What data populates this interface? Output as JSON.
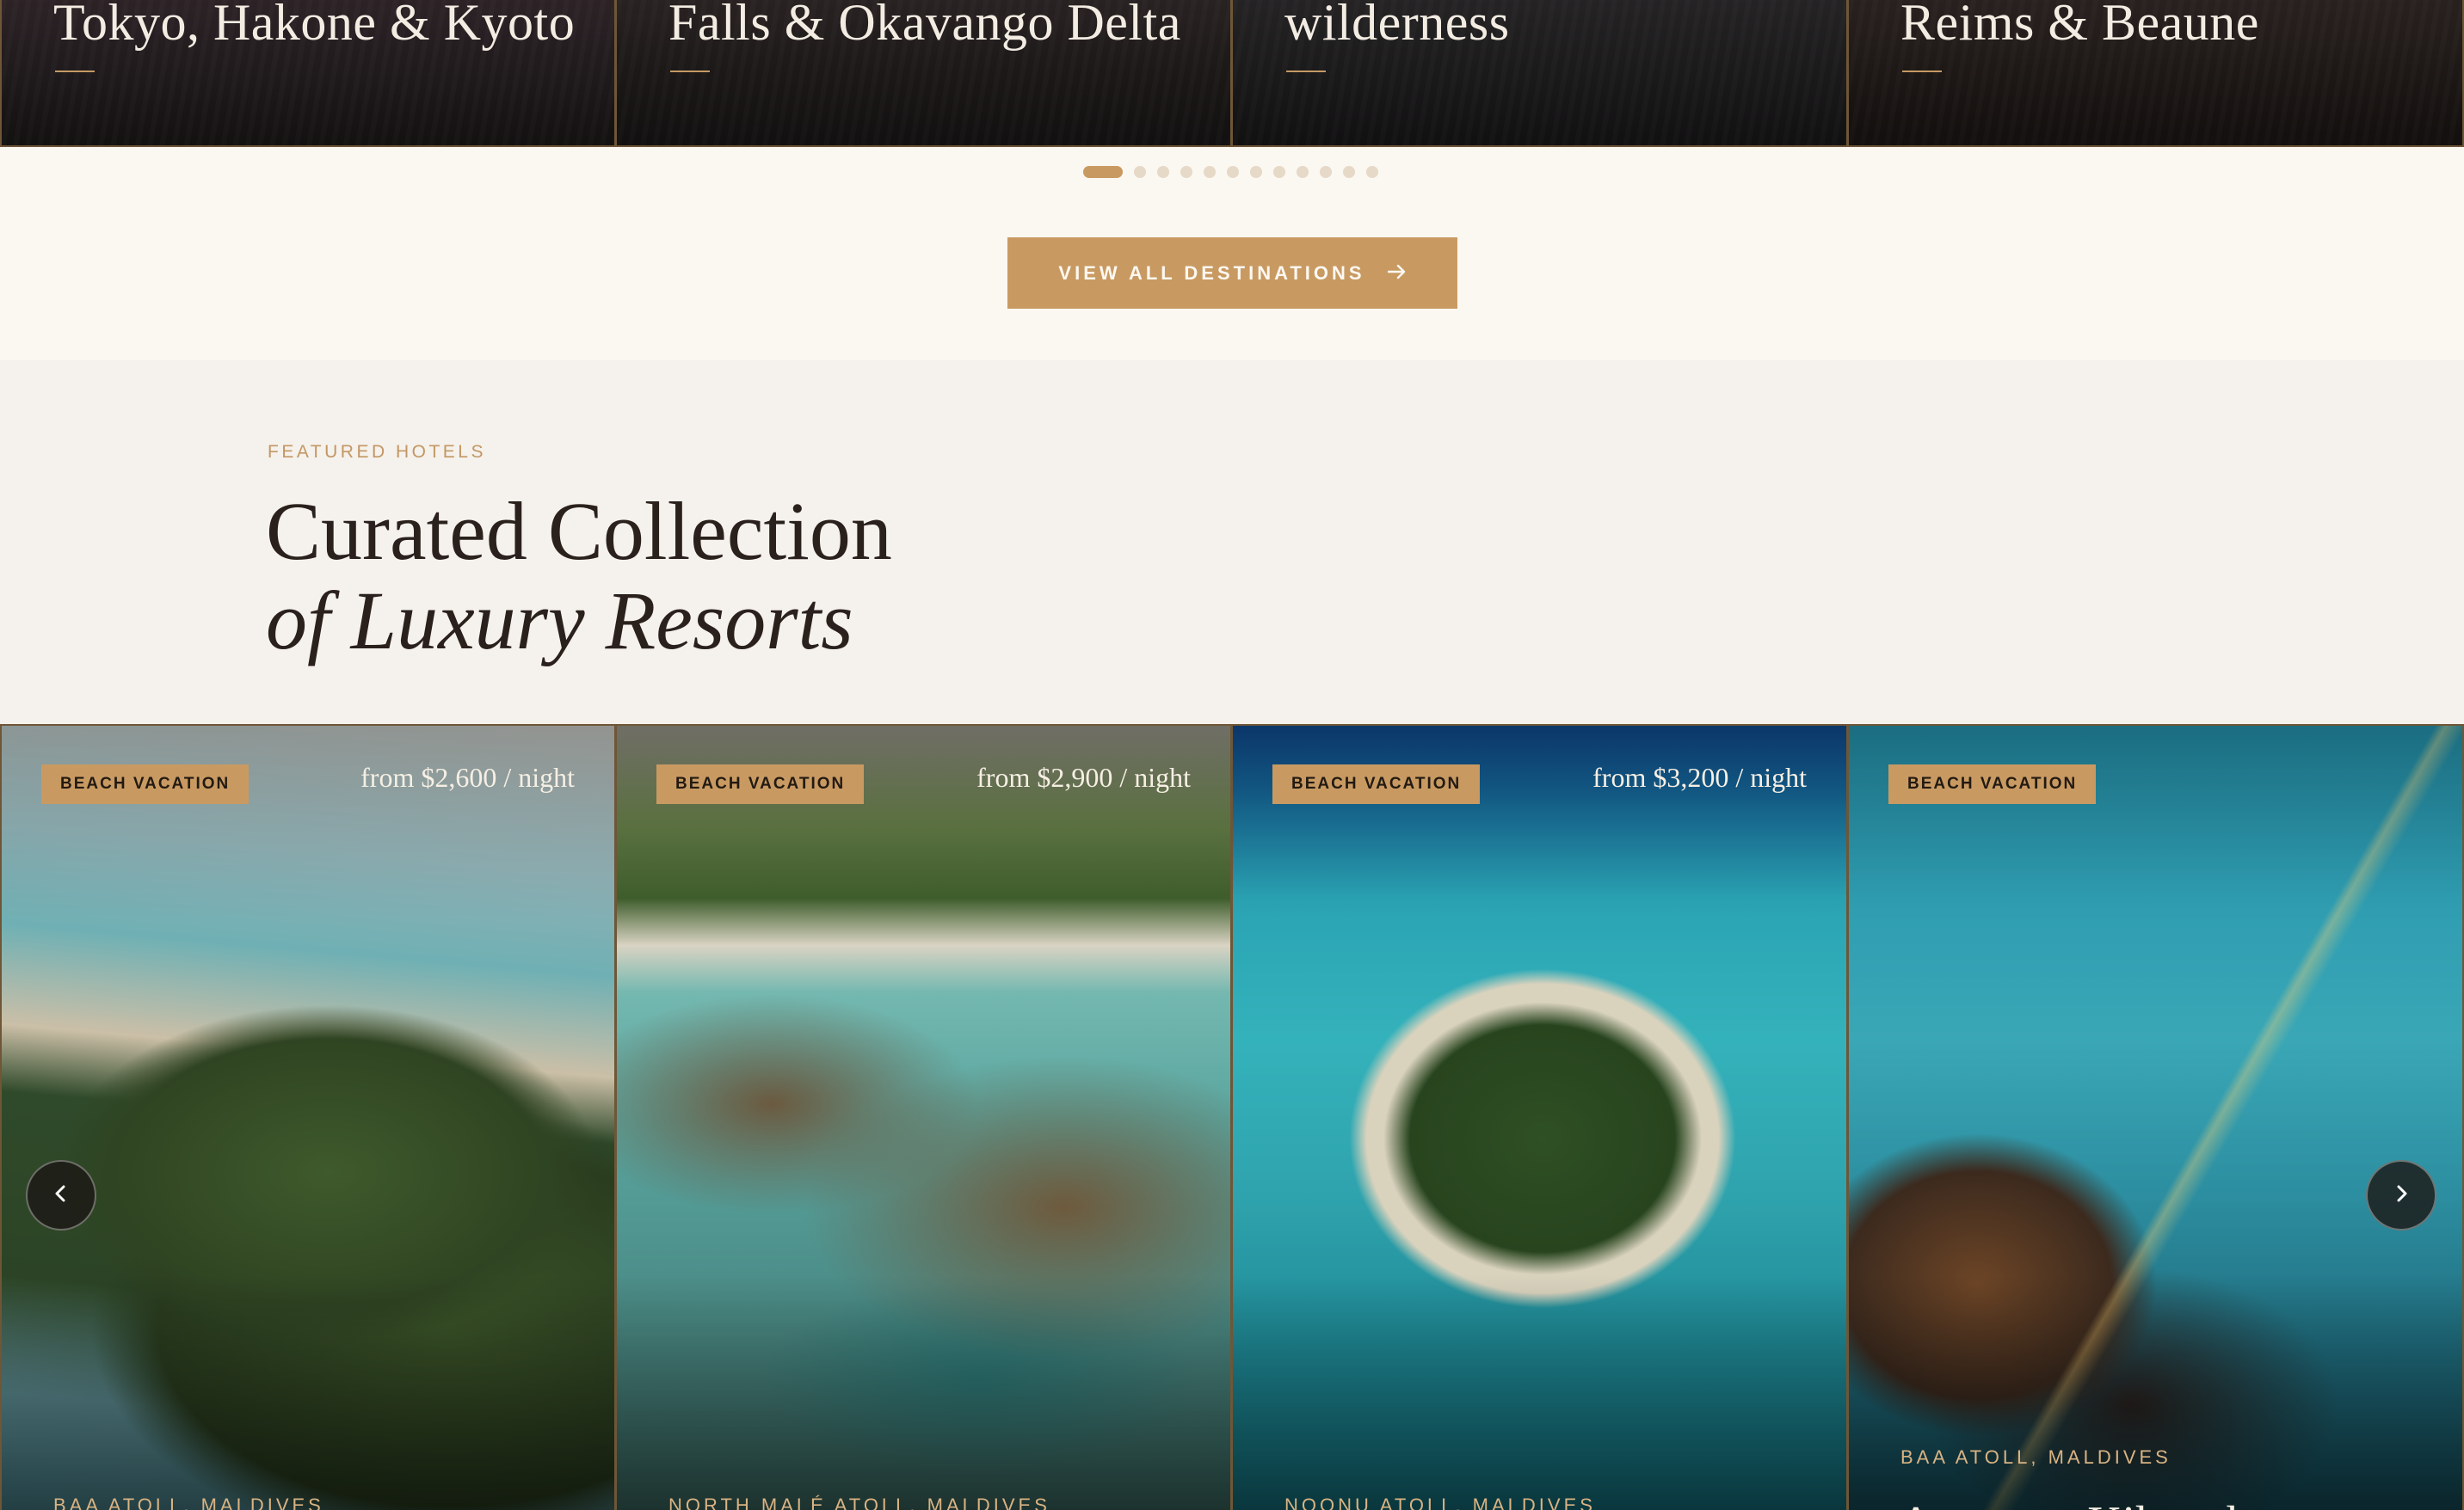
{
  "destinations": [
    {
      "title": "Tokyo, Hakone & Kyoto"
    },
    {
      "title": "Falls & Okavango Delta"
    },
    {
      "title": "wilderness"
    },
    {
      "title": "Reims & Beaune"
    }
  ],
  "pagination": {
    "total": 12,
    "active_index": 0
  },
  "cta": {
    "label": "VIEW ALL DESTINATIONS",
    "icon": "arrow-right-icon"
  },
  "featured": {
    "eyebrow": "FEATURED HOTELS",
    "headline_line1": "Curated Collection",
    "headline_line2": "of Luxury Resorts"
  },
  "hotels": [
    {
      "badge": "BEACH VACATION",
      "price": "from $2,600 / night",
      "location": "BAA ATOLL, MALDIVES",
      "name": ""
    },
    {
      "badge": "BEACH VACATION",
      "price": "from $2,900 / night",
      "location": "NORTH MALÉ ATOLL, MALDIVES",
      "name": ""
    },
    {
      "badge": "BEACH VACATION",
      "price": "from $3,200 / night",
      "location": "NOONU ATOLL, MALDIVES",
      "name": ""
    },
    {
      "badge": "BEACH VACATION",
      "price": "",
      "location": "BAA ATOLL, MALDIVES",
      "name": "Anantara Kihavah"
    }
  ],
  "carousel": {
    "prev_icon": "chevron-left-icon",
    "next_icon": "chevron-right-icon"
  },
  "colors": {
    "accent": "#c89a62",
    "dark": "#1c1816",
    "cream": "#fbf7f1"
  }
}
